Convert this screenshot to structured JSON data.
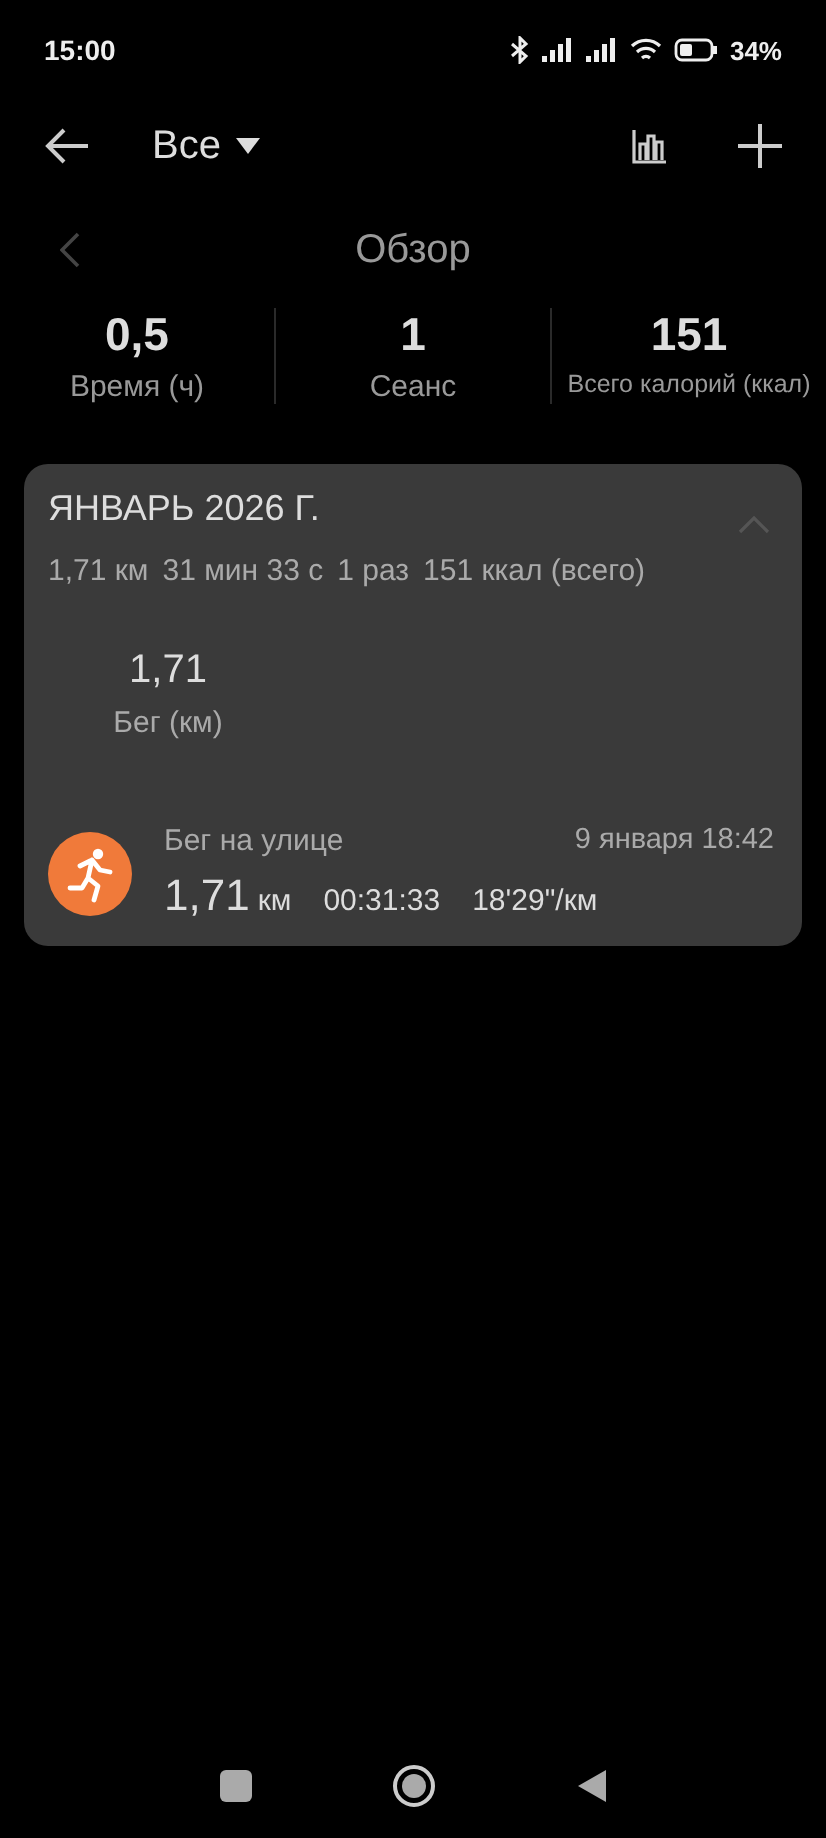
{
  "status_bar": {
    "time": "15:00",
    "battery": "34%"
  },
  "toolbar": {
    "filter": "Все"
  },
  "overview": {
    "title": "Обзор"
  },
  "stats": [
    {
      "value": "0,5",
      "label": "Время (ч)"
    },
    {
      "value": "1",
      "label": "Сеанс"
    },
    {
      "value": "151",
      "label": "Всего калорий (ккал)"
    }
  ],
  "month_card": {
    "title": "ЯНВАРЬ 2026 Г.",
    "expanded": true,
    "summary": [
      "1,71 км",
      "31 мин 33 с",
      "1 раз",
      "151 ккал (всего)"
    ],
    "total": {
      "value": "1,71",
      "label": "Бег (км)"
    },
    "activities": [
      {
        "name": "Бег на улице",
        "date": "9 января 18:42",
        "distance": "1,71",
        "distance_unit": "км",
        "duration": "00:31:33",
        "pace": "18'29\"/км"
      }
    ]
  }
}
